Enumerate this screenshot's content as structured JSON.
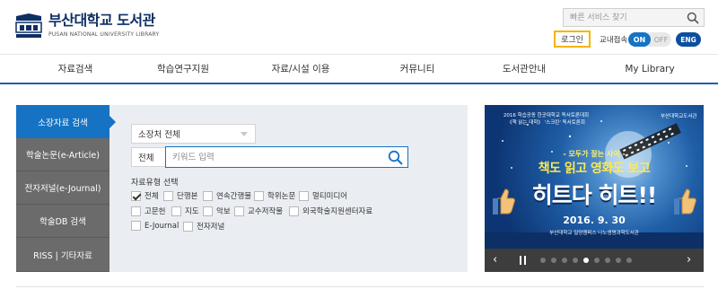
{
  "header": {
    "logo_kr": "부산대학교 도서관",
    "logo_en": "PUSAN NATIONAL UNIVERSITY LIBRARY",
    "quick_search_placeholder": "빠른 서비스 찾기",
    "login_label": "로그인",
    "campus_label": "교내접속",
    "toggle_on": "ON",
    "toggle_off": "OFF",
    "lang_label": "ENG"
  },
  "nav": {
    "items": [
      "자료검색",
      "학습연구지원",
      "자료/시설 이용",
      "커뮤니티",
      "도서관안내",
      "My Library"
    ]
  },
  "search": {
    "tabs": [
      "소장자료 검색",
      "학술논문(e-Article)",
      "전자저널(e-Journal)",
      "학술DB 검색",
      "RISS | 기타자료"
    ],
    "active_tab": 0,
    "location_select": "소장처 전체",
    "field_select": "전체",
    "keyword_placeholder": "키워드 입력",
    "type_title": "자료유형 선택",
    "types": [
      "전체",
      "단행본",
      "연속간행물",
      "학위논문",
      "멀티미디어",
      "고문헌",
      "지도",
      "악보",
      "교수저작물",
      "외국학술지원센터자료",
      "E-Journal",
      "전자저널"
    ],
    "checked": [
      "전체"
    ]
  },
  "banner": {
    "top_line1": "2016 학습공동 한곳대학교 독서토론대회",
    "top_line2": "《책 읽는 대학》 '스크린' 독서토론회",
    "logo_text": "부산대학교도서관",
    "small_text": "- 모두가 잘는 사이 -",
    "mid_text": "책도 읽고 영화도 보고",
    "big_text": "히트다 히트!!",
    "date_text": "2016. 9. 30",
    "venue_text": "부산대학교 밀양캠퍼스 나노생명과학도서관",
    "slide_count": 9,
    "active_slide": 4
  }
}
